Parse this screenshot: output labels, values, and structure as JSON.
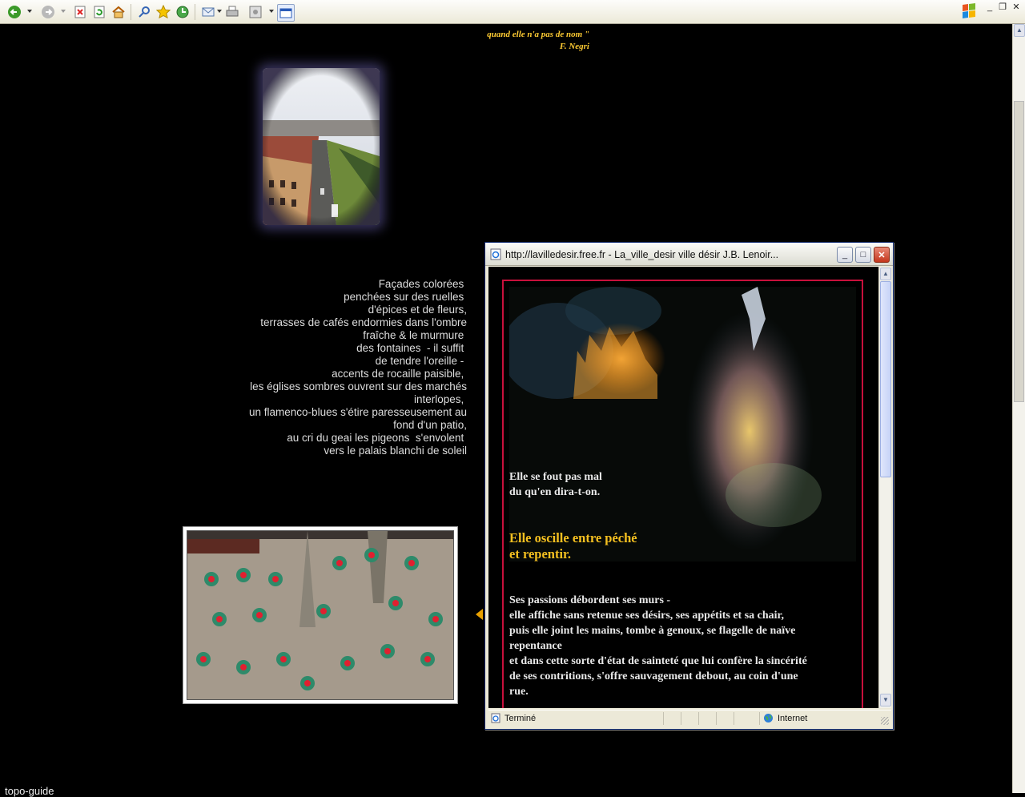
{
  "browser": {
    "toolbar_icons": [
      "back-icon",
      "forward-icon",
      "stop-icon",
      "refresh-icon",
      "home-icon",
      "search-icon",
      "favorites-icon",
      "history-icon",
      "mail-icon",
      "print-icon",
      "edit-icon",
      "new-window-icon"
    ],
    "window_controls": [
      "minimize",
      "restore",
      "close"
    ]
  },
  "page": {
    "quote_line1": "quand elle n'a pas de nom \"",
    "quote_author": "F. Negri",
    "poem_lines": [
      "Façades colorées ",
      "penchées sur des ruelles ",
      "d'épices et de fleurs,",
      "terrasses de cafés endormies dans l'ombre",
      "fraîche & le murmure ",
      "des fontaines  - il suffit ",
      "de tendre l'oreille - ",
      "accents de rocaille paisible, ",
      "les églises sombres ouvrent sur des marchés",
      "interlopes, ",
      "un flamenco-blues s'étire paresseusement au",
      "fond d'un patio,",
      "au cri du geai les pigeons  s'envolent ",
      "vers le palais blanchi de soleil"
    ],
    "footer_text": "topo-guide"
  },
  "popup": {
    "title": "http://lavilledesir.free.fr - La_ville_desir  ville désir J.B. Lenoir...",
    "text1_line1": "Elle se fout pas mal",
    "text1_line2": "du qu'en dira-t-on.",
    "highlight_line1": "Elle oscille entre péché",
    "highlight_line2": "et repentir.",
    "body_lines": [
      "Ses passions débordent ses murs -",
      "elle affiche sans retenue ses désirs, ses appétits et sa chair,",
      "puis elle joint les mains, tombe à genoux, se flagelle de naïve",
      "repentance",
      "et dans cette sorte d'état de sainteté que lui confère la sincérité",
      "de ses contritions,  s'offre sauvagement debout, au coin d'une",
      "rue."
    ],
    "status_text": "Terminé",
    "zone_text": "Internet",
    "colors": {
      "frame": "#c8103c",
      "highlight": "#f5c020"
    }
  }
}
